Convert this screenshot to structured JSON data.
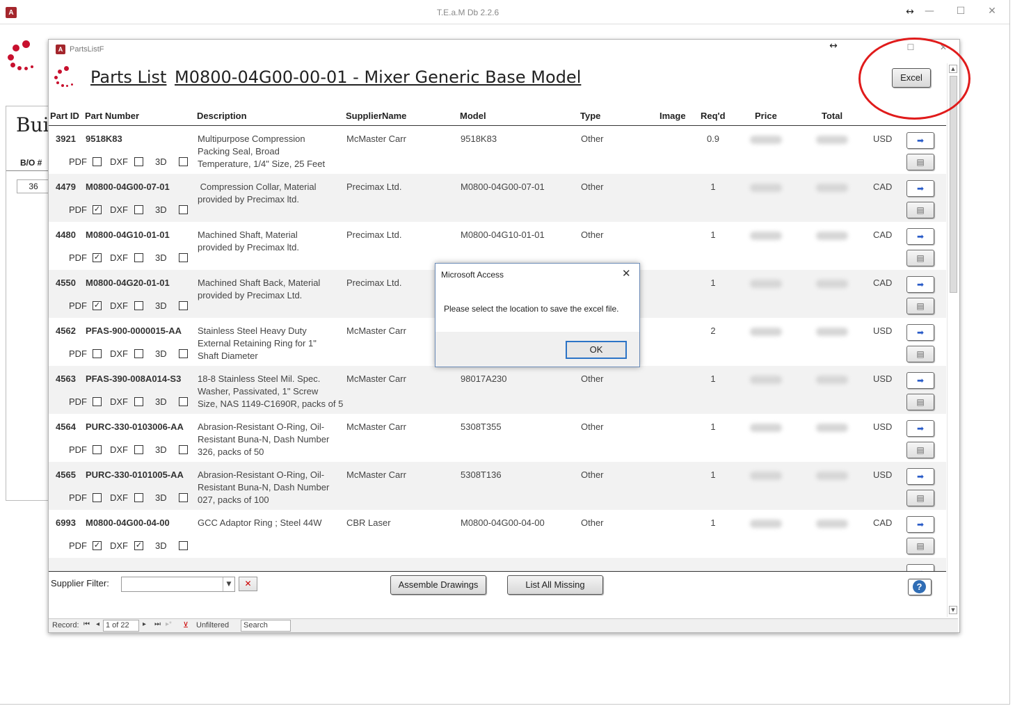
{
  "app": {
    "title": "T.E.a.M Db 2.2.6",
    "bg_form": {
      "title_partial": "Bui",
      "bo_label": "B/O #",
      "bo_value": "36"
    }
  },
  "parts_window": {
    "tab_title": "PartsListF",
    "heading": "Parts List",
    "model_title": "M0800-04G00-00-01 - Mixer Generic Base Model",
    "excel_label": "Excel",
    "columns": [
      "Part ID",
      "Part Number",
      "Description",
      "SupplierName",
      "Model",
      "Type",
      "Image",
      "Req'd",
      "Price",
      "Total"
    ],
    "checkbox_labels": {
      "pdf": "PDF",
      "dxf": "DXF",
      "threed": "3D"
    },
    "rows": [
      {
        "id": "3921",
        "part_number": "9518K83",
        "description": [
          "Multipurpose Compression",
          "Packing Seal, Broad",
          "Temperature, 1/4\" Size, 25 Feet"
        ],
        "supplier": "McMaster Carr",
        "model": "9518K83",
        "type": "Other",
        "reqd": "0.9",
        "currency": "USD",
        "pdf": false,
        "dxf": false,
        "threed": false
      },
      {
        "id": "4479",
        "part_number": "M0800-04G00-07-01",
        "description": [
          " Compression Collar, Material",
          "provided by Precimax ltd."
        ],
        "supplier": "Precimax Ltd.",
        "model": "M0800-04G00-07-01",
        "type": "Other",
        "reqd": "1",
        "currency": "CAD",
        "pdf": true,
        "dxf": false,
        "threed": false
      },
      {
        "id": "4480",
        "part_number": "M0800-04G10-01-01",
        "description": [
          "Machined Shaft, Material",
          "provided by Precimax ltd."
        ],
        "supplier": "Precimax Ltd.",
        "model": "M0800-04G10-01-01",
        "type": "Other",
        "reqd": "1",
        "currency": "CAD",
        "pdf": true,
        "dxf": false,
        "threed": false
      },
      {
        "id": "4550",
        "part_number": "M0800-04G20-01-01",
        "description": [
          "Machined Shaft Back, Material",
          "provided by Precimax Ltd."
        ],
        "supplier": "Precimax Ltd.",
        "model": "",
        "type": "",
        "reqd": "1",
        "currency": "CAD",
        "pdf": true,
        "dxf": false,
        "threed": false
      },
      {
        "id": "4562",
        "part_number": "PFAS-900-0000015-AA",
        "description": [
          "Stainless Steel Heavy Duty",
          "External Retaining Ring for 1\"",
          "Shaft Diameter"
        ],
        "supplier": "McMaster Carr",
        "model": "",
        "type": "",
        "reqd": "2",
        "currency": "USD",
        "pdf": false,
        "dxf": false,
        "threed": false
      },
      {
        "id": "4563",
        "part_number": "PFAS-390-008A014-S3",
        "description": [
          "18-8 Stainless Steel Mil. Spec.",
          "Washer, Passivated, 1\" Screw",
          "Size, NAS 1149-C1690R, packs of 5"
        ],
        "supplier": "McMaster Carr",
        "model": "98017A230",
        "type": "Other",
        "reqd": "1",
        "currency": "USD",
        "pdf": false,
        "dxf": false,
        "threed": false
      },
      {
        "id": "4564",
        "part_number": "PURC-330-0103006-AA",
        "description": [
          "Abrasion-Resistant O-Ring, Oil-",
          "Resistant Buna-N, Dash Number",
          "326, packs of 50"
        ],
        "supplier": "McMaster Carr",
        "model": "5308T355",
        "type": "Other",
        "reqd": "1",
        "currency": "USD",
        "pdf": false,
        "dxf": false,
        "threed": false
      },
      {
        "id": "4565",
        "part_number": "PURC-330-0101005-AA",
        "description": [
          "Abrasion-Resistant O-Ring, Oil-",
          "Resistant Buna-N, Dash Number",
          "027, packs of 100"
        ],
        "supplier": "McMaster Carr",
        "model": "5308T136",
        "type": "Other",
        "reqd": "1",
        "currency": "USD",
        "pdf": false,
        "dxf": false,
        "threed": false
      },
      {
        "id": "6993",
        "part_number": "M0800-04G00-04-00",
        "description": [
          "GCC Adaptor Ring ; Steel 44W"
        ],
        "supplier": "CBR Laser",
        "model": "M0800-04G00-04-00",
        "type": "Other",
        "reqd": "1",
        "currency": "CAD",
        "pdf": true,
        "dxf": true,
        "threed": false
      }
    ],
    "footer": {
      "supplier_filter_label": "Supplier Filter:",
      "supplier_filter_value": "",
      "assemble_label": "Assemble Drawings",
      "list_missing_label": "List All Missing"
    },
    "nav": {
      "record_label": "Record:",
      "record_value": "1 of 22",
      "filter_label": "Unfiltered",
      "search_label": "Search"
    }
  },
  "dialog": {
    "title": "Microsoft Access",
    "message": "Please select the location to save the excel file.",
    "ok_label": "OK"
  },
  "colors": {
    "brand_red": "#c8102e",
    "annotation_red": "#e01b1b",
    "access_red": "#a4262c",
    "link_blue": "#2a5cc8"
  }
}
